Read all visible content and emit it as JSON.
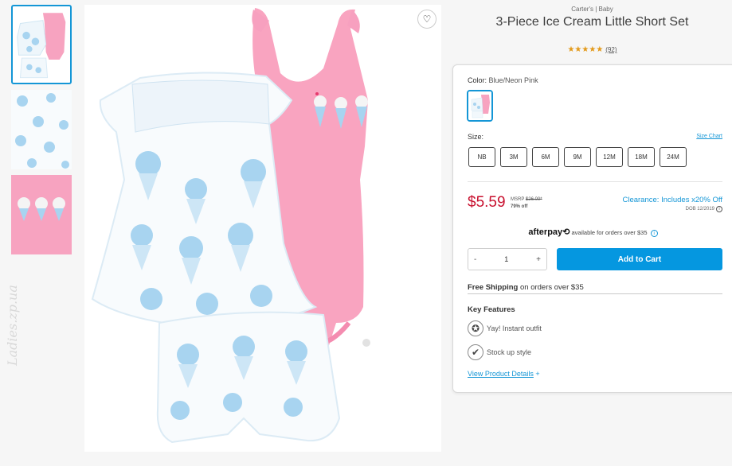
{
  "product": {
    "brand": "Carter's | Baby",
    "title": "3-Piece Ice Cream Little Short Set",
    "stars": "★★★★★",
    "review_count": "(92)",
    "rating_value": 5
  },
  "color": {
    "label": "Color:",
    "value": "Blue/Neon Pink"
  },
  "size": {
    "label": "Size:",
    "chart_link": "Size Chart",
    "options": [
      "NB",
      "3M",
      "6M",
      "9M",
      "12M",
      "18M",
      "24M"
    ]
  },
  "pricing": {
    "price": "$5.59",
    "msrp_label": "MSRP",
    "msrp_value": "$26.00*",
    "discount": "79% off",
    "clearance": "Clearance: Includes x20% Off",
    "dob": "DOB 12/2019",
    "info_glyph": "i"
  },
  "afterpay": {
    "brand": "afterpay",
    "logo_glyph": "⟲",
    "text": "available for orders over $35",
    "info_glyph": "i"
  },
  "quantity": {
    "minus": "-",
    "value": "1",
    "plus": "+"
  },
  "cart": {
    "label": "Add to Cart"
  },
  "shipping": {
    "bold": "Free Shipping",
    "text": "on orders over $35"
  },
  "features": {
    "heading": "Key Features",
    "items": [
      {
        "icon": "badge-icon",
        "glyph": "✪",
        "text": "Yay! Instant outfit"
      },
      {
        "icon": "checkmark-icon",
        "glyph": "✔",
        "text": "Stock up style"
      }
    ],
    "details_link": "View Product Details",
    "details_plus": "+"
  },
  "favorite": {
    "icon": "heart-icon",
    "glyph": "♡"
  },
  "watermark": "Ladies.zp.ua",
  "colors": {
    "accent": "#1496d6",
    "price": "#c8102e",
    "cart": "#0597e0",
    "pink": "#f7a0bf"
  }
}
